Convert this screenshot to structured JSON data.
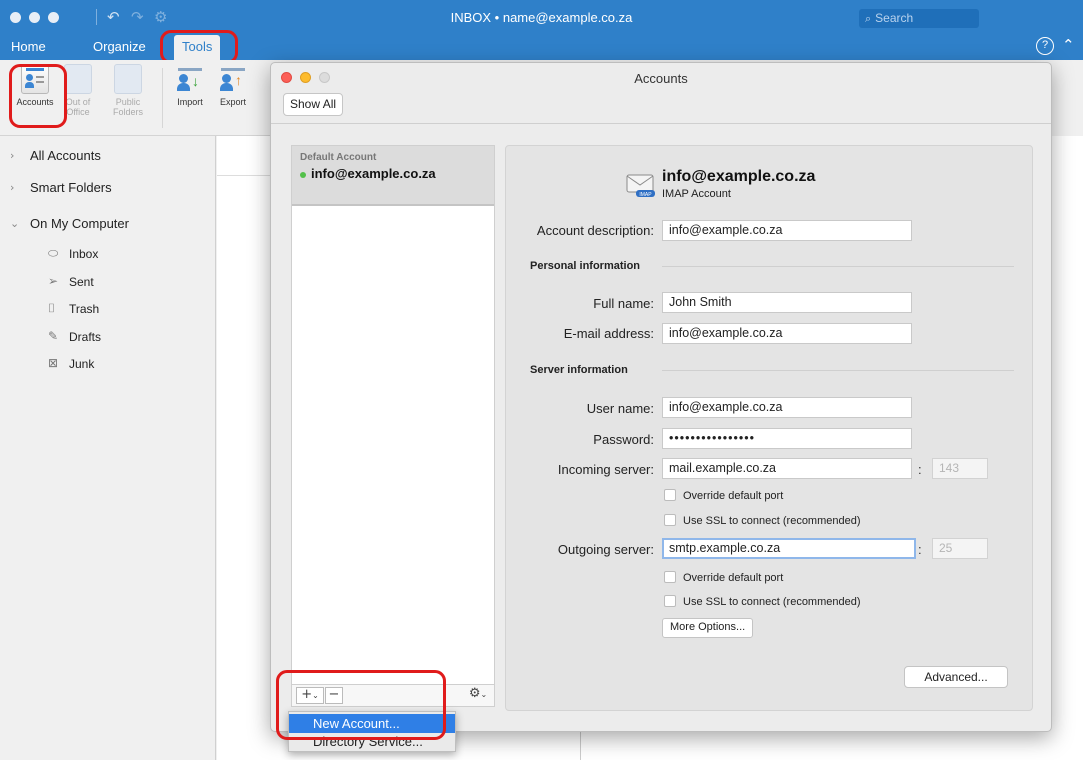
{
  "titlebar": {
    "title": "INBOX • name@example.co.za",
    "search_placeholder": "Search",
    "undo_icon": "undo-icon",
    "redo_icon": "redo-icon"
  },
  "ribbon": {
    "tabs": [
      "Home",
      "Organize",
      "Tools"
    ],
    "active_tab": "Tools",
    "buttons": [
      {
        "label": "Accounts",
        "icon": "accounts-icon"
      },
      {
        "label": "Out of Office",
        "icon": "out-of-office-icon"
      },
      {
        "label": "Public Folders",
        "icon": "public-folders-icon"
      },
      {
        "label": "Import",
        "icon": "import-icon"
      },
      {
        "label": "Export",
        "icon": "export-icon"
      }
    ]
  },
  "folders": {
    "groups": [
      "All Accounts",
      "Smart Folders",
      "On My Computer"
    ],
    "items": [
      "Inbox",
      "Sent",
      "Trash",
      "Drafts",
      "Junk"
    ]
  },
  "dialog": {
    "title": "Accounts",
    "show_all": "Show All",
    "list": {
      "group_label": "Default Account",
      "account": "info@example.co.za",
      "status_color": "#53c04a"
    },
    "detail": {
      "email": "info@example.co.za",
      "account_type": "IMAP Account",
      "account_description_label": "Account description:",
      "account_description": "info@example.co.za",
      "personal_section": "Personal information",
      "full_name_label": "Full name:",
      "full_name": "John Smith",
      "email_label": "E-mail address:",
      "email_value": "info@example.co.za",
      "server_section": "Server information",
      "username_label": "User name:",
      "username": "info@example.co.za",
      "password_label": "Password:",
      "password": "••••••••••••••••",
      "incoming_label": "Incoming server:",
      "incoming": "mail.example.co.za",
      "incoming_port": "143",
      "outgoing_label": "Outgoing server:",
      "outgoing": "smtp.example.co.za",
      "outgoing_port": "25",
      "override_port": "Override default port",
      "use_ssl": "Use SSL to connect (recommended)",
      "more_options": "More Options...",
      "advanced": "Advanced..."
    },
    "footer": {
      "add": "+",
      "remove": "−",
      "gear_icon": "gear-icon"
    },
    "menu": {
      "items": [
        "New Account...",
        "Directory Service..."
      ],
      "highlighted": "New Account..."
    }
  },
  "colors": {
    "accent": "#2f80c9",
    "highlight_ring": "#e01b1b",
    "menu_selection": "#2f7fe6"
  }
}
